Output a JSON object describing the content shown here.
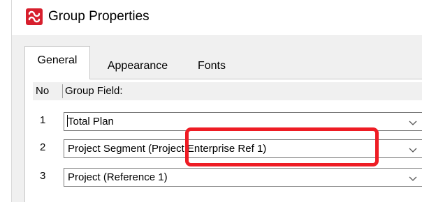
{
  "window": {
    "title": "Group Properties",
    "icon": "app-logo-icon",
    "colors": {
      "icon": "#d71f2d",
      "highlight": "#ee1c24",
      "panel": "#ffffff",
      "chrome": "#f0f0f0"
    }
  },
  "tabs": [
    {
      "label": "General",
      "active": true
    },
    {
      "label": "Appearance",
      "active": false
    },
    {
      "label": "Fonts",
      "active": false
    }
  ],
  "grid": {
    "header_no": "No",
    "header_field": "Group Field:",
    "rows": [
      {
        "no": "1",
        "value": "Total Plan"
      },
      {
        "no": "2",
        "value": "Project Segment (Project Enterprise Ref 1)"
      },
      {
        "no": "3",
        "value": "Project (Reference 1)"
      }
    ]
  }
}
